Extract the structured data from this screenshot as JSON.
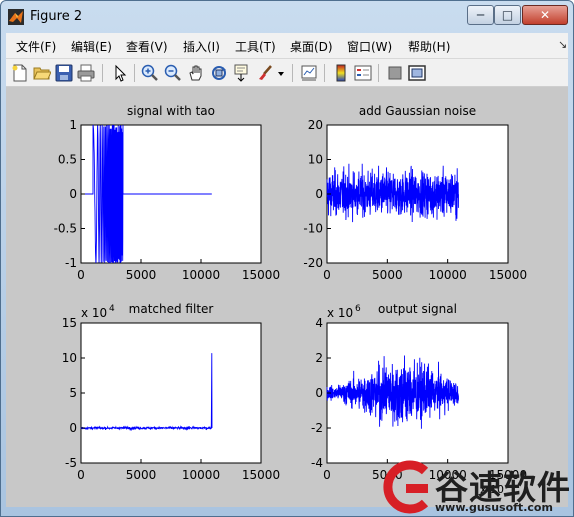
{
  "window": {
    "title": "Figure 2",
    "buttons": {
      "minimize": "─",
      "maximize": "□",
      "close": "✕"
    }
  },
  "menu": {
    "items": [
      "文件(F)",
      "编辑(E)",
      "查看(V)",
      "插入(I)",
      "工具(T)",
      "桌面(D)",
      "窗口(W)",
      "帮助(H)"
    ]
  },
  "toolbar": {
    "icons": [
      "new-figure-icon",
      "open-folder-icon",
      "save-icon",
      "print-icon",
      "pointer-icon",
      "zoom-in-icon",
      "zoom-out-icon",
      "pan-hand-icon",
      "rotate-3d-icon",
      "data-cursor-icon",
      "brush-icon",
      "brush-dropdown-icon",
      "link-plot-icon",
      "colorbar-icon",
      "legend-icon",
      "hide-plot-tools-icon",
      "show-plot-tools-icon"
    ]
  },
  "colors": {
    "series": "#0000ff",
    "figure_bg": "#c8c8c8",
    "axes_bg": "#ffffff"
  },
  "chart_data": [
    {
      "type": "line",
      "title": "signal with tao",
      "xlim": [
        0,
        15000
      ],
      "ylim": [
        -1,
        1
      ],
      "xticks": [
        0,
        5000,
        10000,
        15000
      ],
      "yticks": [
        -1,
        -0.5,
        0,
        0.5,
        1
      ],
      "xtick_labels": [
        "0",
        "5000",
        "10000",
        "15000"
      ],
      "ytick_labels": [
        "-1",
        "-0.5",
        "0",
        "0.5",
        "1"
      ],
      "exponent": "",
      "grid": false,
      "series": [
        {
          "kind": "chirp-burst",
          "x_start": 0,
          "zero_until": 1000,
          "burst_end": 3500,
          "x_end": 10900,
          "amplitude": 1
        }
      ]
    },
    {
      "type": "line",
      "title": "add Gaussian noise",
      "xlim": [
        0,
        15000
      ],
      "ylim": [
        -20,
        20
      ],
      "xticks": [
        0,
        5000,
        10000,
        15000
      ],
      "yticks": [
        -20,
        -10,
        0,
        10,
        20
      ],
      "xtick_labels": [
        "0",
        "5000",
        "10000",
        "15000"
      ],
      "ytick_labels": [
        "-20",
        "-10",
        "0",
        "10",
        "20"
      ],
      "exponent": "",
      "grid": false,
      "series": [
        {
          "kind": "noise",
          "x_start": 0,
          "x_end": 10900,
          "typical_amplitude": 10,
          "peak_amplitude": 13
        }
      ]
    },
    {
      "type": "line",
      "title": "matched filter",
      "xlim": [
        0,
        15000
      ],
      "ylim": [
        -5,
        15
      ],
      "xticks": [
        0,
        5000,
        10000,
        15000
      ],
      "yticks": [
        -5,
        0,
        5,
        10,
        15
      ],
      "xtick_labels": [
        "0",
        "5000",
        "10000",
        "15000"
      ],
      "ytick_labels": [
        "-5",
        "0",
        "5",
        "10",
        "15"
      ],
      "exponent": "x 10",
      "exponent_power": "4",
      "grid": false,
      "series": [
        {
          "kind": "flat-spike",
          "x_start": 0,
          "x_end": 10900,
          "baseline": 0,
          "spike_x": 10900,
          "spike_value": 10.7
        }
      ]
    },
    {
      "type": "line",
      "title": "output signal",
      "xlim": [
        0,
        15000
      ],
      "ylim": [
        -4,
        4
      ],
      "xticks": [
        0,
        5000,
        10000,
        15000
      ],
      "yticks": [
        -4,
        -2,
        0,
        2,
        4
      ],
      "xtick_labels": [
        "0",
        "5000",
        "10000",
        "15000"
      ],
      "ytick_labels": [
        "-4",
        "-2",
        "0",
        "2",
        "4"
      ],
      "exponent": "x 10",
      "exponent_power": "6",
      "x_exponent": "x 10",
      "grid": false,
      "series": [
        {
          "kind": "noise-envelope",
          "x_start": 0,
          "x_end": 10900,
          "peak_x": 6200,
          "peak_amplitude": 2.6,
          "edge_amplitude": 0.5
        }
      ]
    }
  ],
  "watermark": {
    "brand": "谷速软件",
    "url": "www.gususoft.com"
  }
}
